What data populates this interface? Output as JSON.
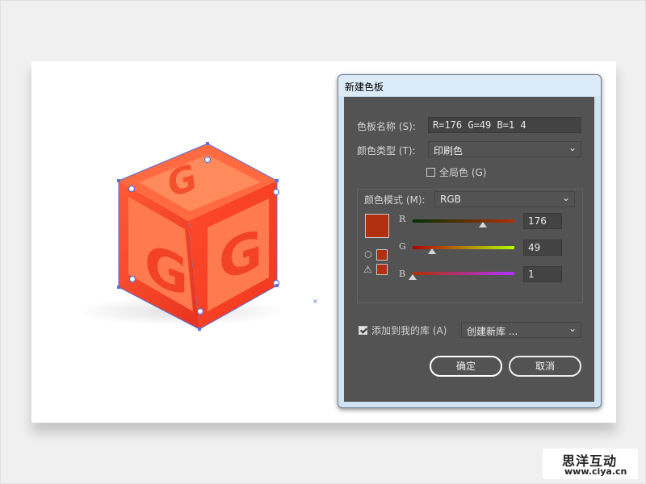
{
  "dialog": {
    "title": "新建色板",
    "swatch_name_label": "色板名称 (S):",
    "swatch_name_value": "R=176 G=49 B=1 4",
    "color_type_label": "颜色类型 (T):",
    "color_type_value": "印刷色",
    "global_label": "全局色 (G)",
    "global_checked": false,
    "color_mode_label": "颜色模式 (M):",
    "color_mode_value": "RGB",
    "channels": [
      {
        "name": "R",
        "value": "176",
        "level": 0.69
      },
      {
        "name": "G",
        "value": "49",
        "level": 0.19
      },
      {
        "name": "B",
        "value": "1",
        "level": 0.0
      }
    ],
    "preview_color": "#b0310f",
    "add_library_label": "添加到我的库 (A)",
    "add_library_checked": true,
    "library_value": "创建新库 ...",
    "ok_label": "确定",
    "cancel_label": "取消"
  },
  "artwork": {
    "cube_letter": "G",
    "top_color": "#ff8a5c",
    "side_color": "#f33f22",
    "panel_color": "#ff7a4e",
    "selection_color": "#5a6fe0"
  },
  "watermark": {
    "title": "思洋互动",
    "url": "www.ciya.cn"
  }
}
